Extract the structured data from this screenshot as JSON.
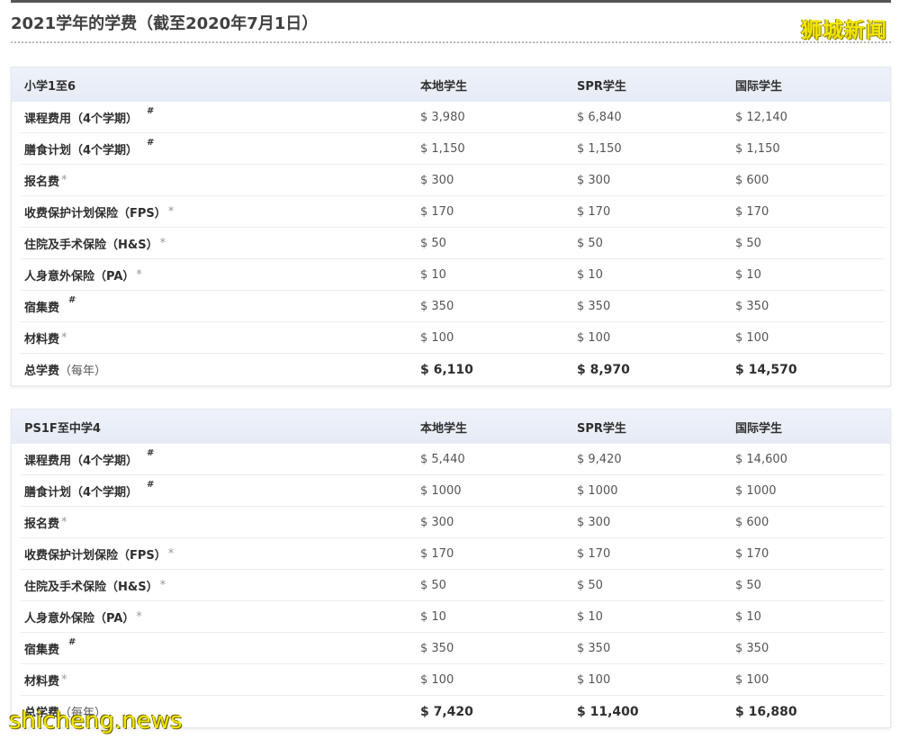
{
  "page": {
    "title": "2021学年的学费（截至2020年7月1日）",
    "watermark_top": "狮城新闻",
    "watermark_bottom": "shicheng.news"
  },
  "table1": {
    "header": {
      "label": "小学1至6",
      "local": "本地学生",
      "spr": "SPR学生",
      "intl": "国际学生"
    },
    "rows": [
      {
        "label": "课程费用（4个学期）",
        "mark": "#",
        "local": "$ 3,980",
        "spr": "$ 6,840",
        "intl": "$ 12,140"
      },
      {
        "label": "膳食计划（4个学期）",
        "mark": "#",
        "local": "$ 1,150",
        "spr": "$ 1,150",
        "intl": "$ 1,150"
      },
      {
        "label": "报名费",
        "mark": "*",
        "local": "$ 300",
        "spr": "$ 300",
        "intl": "$ 600"
      },
      {
        "label": "收费保护计划保险（FPS）",
        "mark": "*",
        "local": "$ 170",
        "spr": "$ 170",
        "intl": "$ 170"
      },
      {
        "label": "住院及手术保险（H&S）",
        "mark": "*",
        "local": "$ 50",
        "spr": "$ 50",
        "intl": "$ 50"
      },
      {
        "label": "人身意外保险（PA）",
        "mark": "*",
        "local": "$ 10",
        "spr": "$ 10",
        "intl": "$ 10"
      },
      {
        "label": "宿集费",
        "mark": "#",
        "local": "$ 350",
        "spr": "$ 350",
        "intl": "$ 350"
      },
      {
        "label": "材料费",
        "mark": "*",
        "local": "$ 100",
        "spr": "$ 100",
        "intl": "$ 100"
      }
    ],
    "total": {
      "label": "总学费",
      "note": "（每年）",
      "local": "$ 6,110",
      "spr": "$ 8,970",
      "intl": "$ 14,570"
    }
  },
  "table2": {
    "header": {
      "label": "PS1F至中学4",
      "local": "本地学生",
      "spr": "SPR学生",
      "intl": "国际学生"
    },
    "rows": [
      {
        "label": "课程费用（4个学期）",
        "mark": "#",
        "local": "$ 5,440",
        "spr": "$ 9,420",
        "intl": "$ 14,600"
      },
      {
        "label": "膳食计划（4个学期）",
        "mark": "#",
        "local": "$ 1000",
        "spr": "$ 1000",
        "intl": "$ 1000"
      },
      {
        "label": "报名费",
        "mark": "*",
        "local": "$ 300",
        "spr": "$ 300",
        "intl": "$ 600"
      },
      {
        "label": "收费保护计划保险（FPS）",
        "mark": "*",
        "local": "$ 170",
        "spr": "$ 170",
        "intl": "$ 170"
      },
      {
        "label": "住院及手术保险（H&S）",
        "mark": "*",
        "local": "$ 50",
        "spr": "$ 50",
        "intl": "$ 50"
      },
      {
        "label": "人身意外保险（PA）",
        "mark": "*",
        "local": "$ 10",
        "spr": "$ 10",
        "intl": "$ 10"
      },
      {
        "label": "宿集费",
        "mark": "#",
        "local": "$ 350",
        "spr": "$ 350",
        "intl": "$ 350"
      },
      {
        "label": "材料费",
        "mark": "*",
        "local": "$ 100",
        "spr": "$ 100",
        "intl": "$ 100"
      }
    ],
    "total": {
      "label": "总学费",
      "note": "（每年）",
      "local": "$ 7,420",
      "spr": "$ 11,400",
      "intl": "$ 16,880"
    }
  }
}
